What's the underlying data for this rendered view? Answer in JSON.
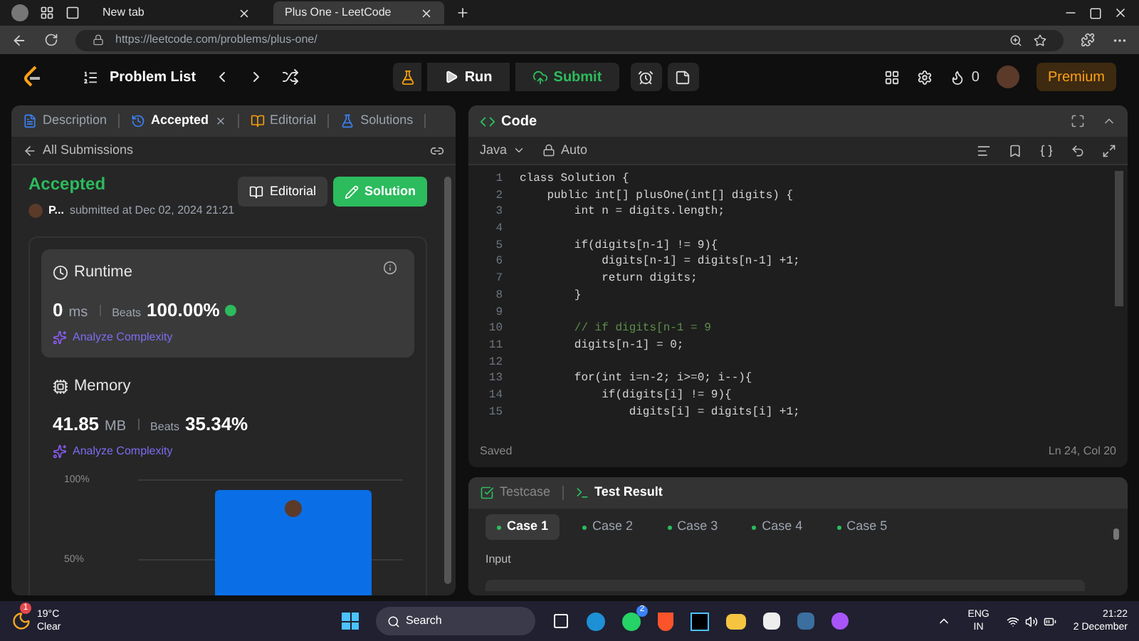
{
  "browser": {
    "tabs": [
      {
        "title": "New tab",
        "selected": false
      },
      {
        "title": "Plus One - LeetCode",
        "selected": true
      }
    ],
    "url": "https://leetcode.com/problems/plus-one/"
  },
  "nav": {
    "problem_list": "Problem List",
    "run": "Run",
    "submit": "Submit",
    "streak": "0",
    "premium": "Premium"
  },
  "left_panel": {
    "tabs": [
      {
        "label": "Description",
        "selected": false,
        "kind": "description"
      },
      {
        "label": "Accepted",
        "selected": true,
        "kind": "accepted"
      },
      {
        "label": "Editorial",
        "selected": false,
        "kind": "editorial"
      },
      {
        "label": "Solutions",
        "selected": false,
        "kind": "solutions"
      }
    ],
    "back_link": "All Submissions",
    "status": "Accepted",
    "user": "P...",
    "submitted": "submitted at Dec 02, 2024 21:21",
    "editorial_button": "Editorial",
    "solution_button": "Solution",
    "runtime": {
      "title": "Runtime",
      "value": "0",
      "unit": "ms",
      "beats_label": "Beats",
      "beats": "100.00%",
      "analyze": "Analyze Complexity"
    },
    "memory": {
      "title": "Memory",
      "value": "41.85",
      "unit": "MB",
      "beats_label": "Beats",
      "beats": "35.34%",
      "analyze": "Analyze Complexity"
    },
    "distribution_chart": {
      "axis_labels": [
        "100%",
        "50%"
      ]
    }
  },
  "code_panel": {
    "title": "Code",
    "language": "Java",
    "mode": "Auto",
    "lines": [
      {
        "num": "1",
        "text": "class Solution {",
        "kind": "code"
      },
      {
        "num": "2",
        "text": "    public int[] plusOne(int[] digits) {",
        "kind": "code"
      },
      {
        "num": "3",
        "text": "        int n = digits.length;",
        "kind": "code"
      },
      {
        "num": "4"
      },
      {
        "num": "5",
        "text": "        if(digits[n-1] != 9){",
        "kind": "code"
      },
      {
        "num": "6",
        "text": "            digits[n-1] = digits[n-1] +1;",
        "kind": "code"
      },
      {
        "num": "7",
        "text": "            return digits;",
        "kind": "code"
      },
      {
        "num": "8",
        "text": "        }",
        "kind": "code"
      },
      {
        "num": "9"
      },
      {
        "num": "10",
        "text": "        // if digits[n-1 = 9",
        "kind": "comment"
      },
      {
        "num": "11",
        "text": "        digits[n-1] = 0;",
        "kind": "code"
      },
      {
        "num": "12"
      },
      {
        "num": "13",
        "text": "        for(int i=n-2; i>=0; i--){",
        "kind": "code"
      },
      {
        "num": "14",
        "text": "            if(digits[i] != 9){",
        "kind": "code"
      },
      {
        "num": "15",
        "text": "                digits[i] = digits[i] +1;",
        "kind": "code"
      }
    ],
    "saved": "Saved",
    "cursor": "Ln 24, Col 20"
  },
  "test_panel": {
    "tabs": [
      {
        "label": "Testcase",
        "selected": false
      },
      {
        "label": "Test Result",
        "selected": true
      }
    ],
    "cases": [
      {
        "label": "Case 1",
        "selected": true
      },
      {
        "label": "Case 2",
        "selected": false
      },
      {
        "label": "Case 3",
        "selected": false
      },
      {
        "label": "Case 4",
        "selected": false
      },
      {
        "label": "Case 5",
        "selected": false
      }
    ],
    "input_label": "Input"
  },
  "taskbar": {
    "weather_badge": "1",
    "temperature": "19°C",
    "condition": "Clear",
    "search": "Search",
    "chat_badge": "2",
    "language": "ENG",
    "region": "IN",
    "time": "21:22",
    "date": "2 December"
  }
}
